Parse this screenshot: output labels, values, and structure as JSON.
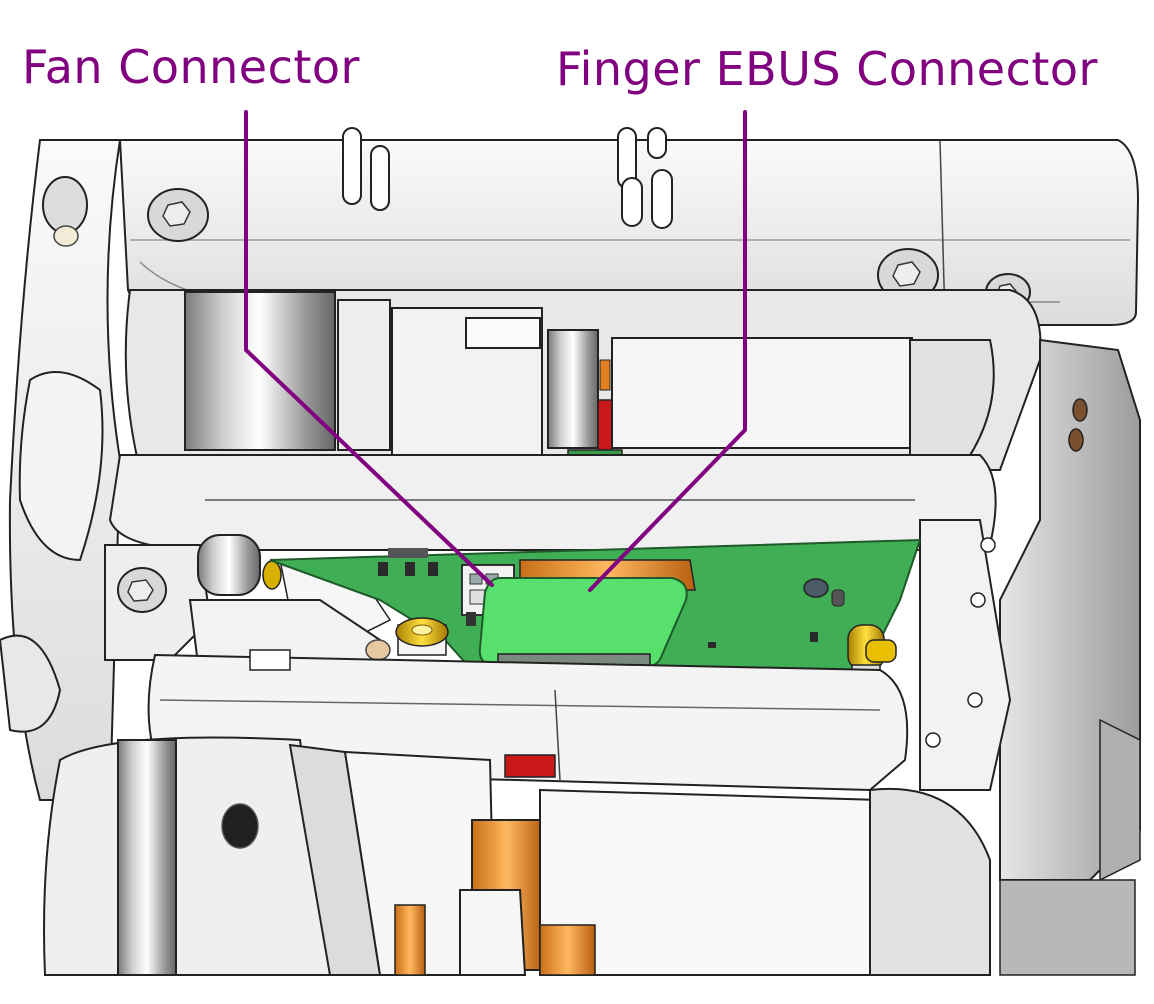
{
  "callouts": {
    "fan_connector": "Fan Connector",
    "finger_ebus_connector": "Finger EBUS Connector"
  },
  "colors": {
    "callout": "#800080",
    "pcb": "#3fae54",
    "ebus_board": "#57e06c",
    "orange_flex": "#f0a040",
    "red_part": "#c81818",
    "gold_part": "#d8b000",
    "metal_light": "#f4f4f4",
    "metal_shade": "#b8b8b8"
  },
  "icons": [
    "hex-screw-icon",
    "fan-connector-icon",
    "ebus-connector-icon"
  ]
}
